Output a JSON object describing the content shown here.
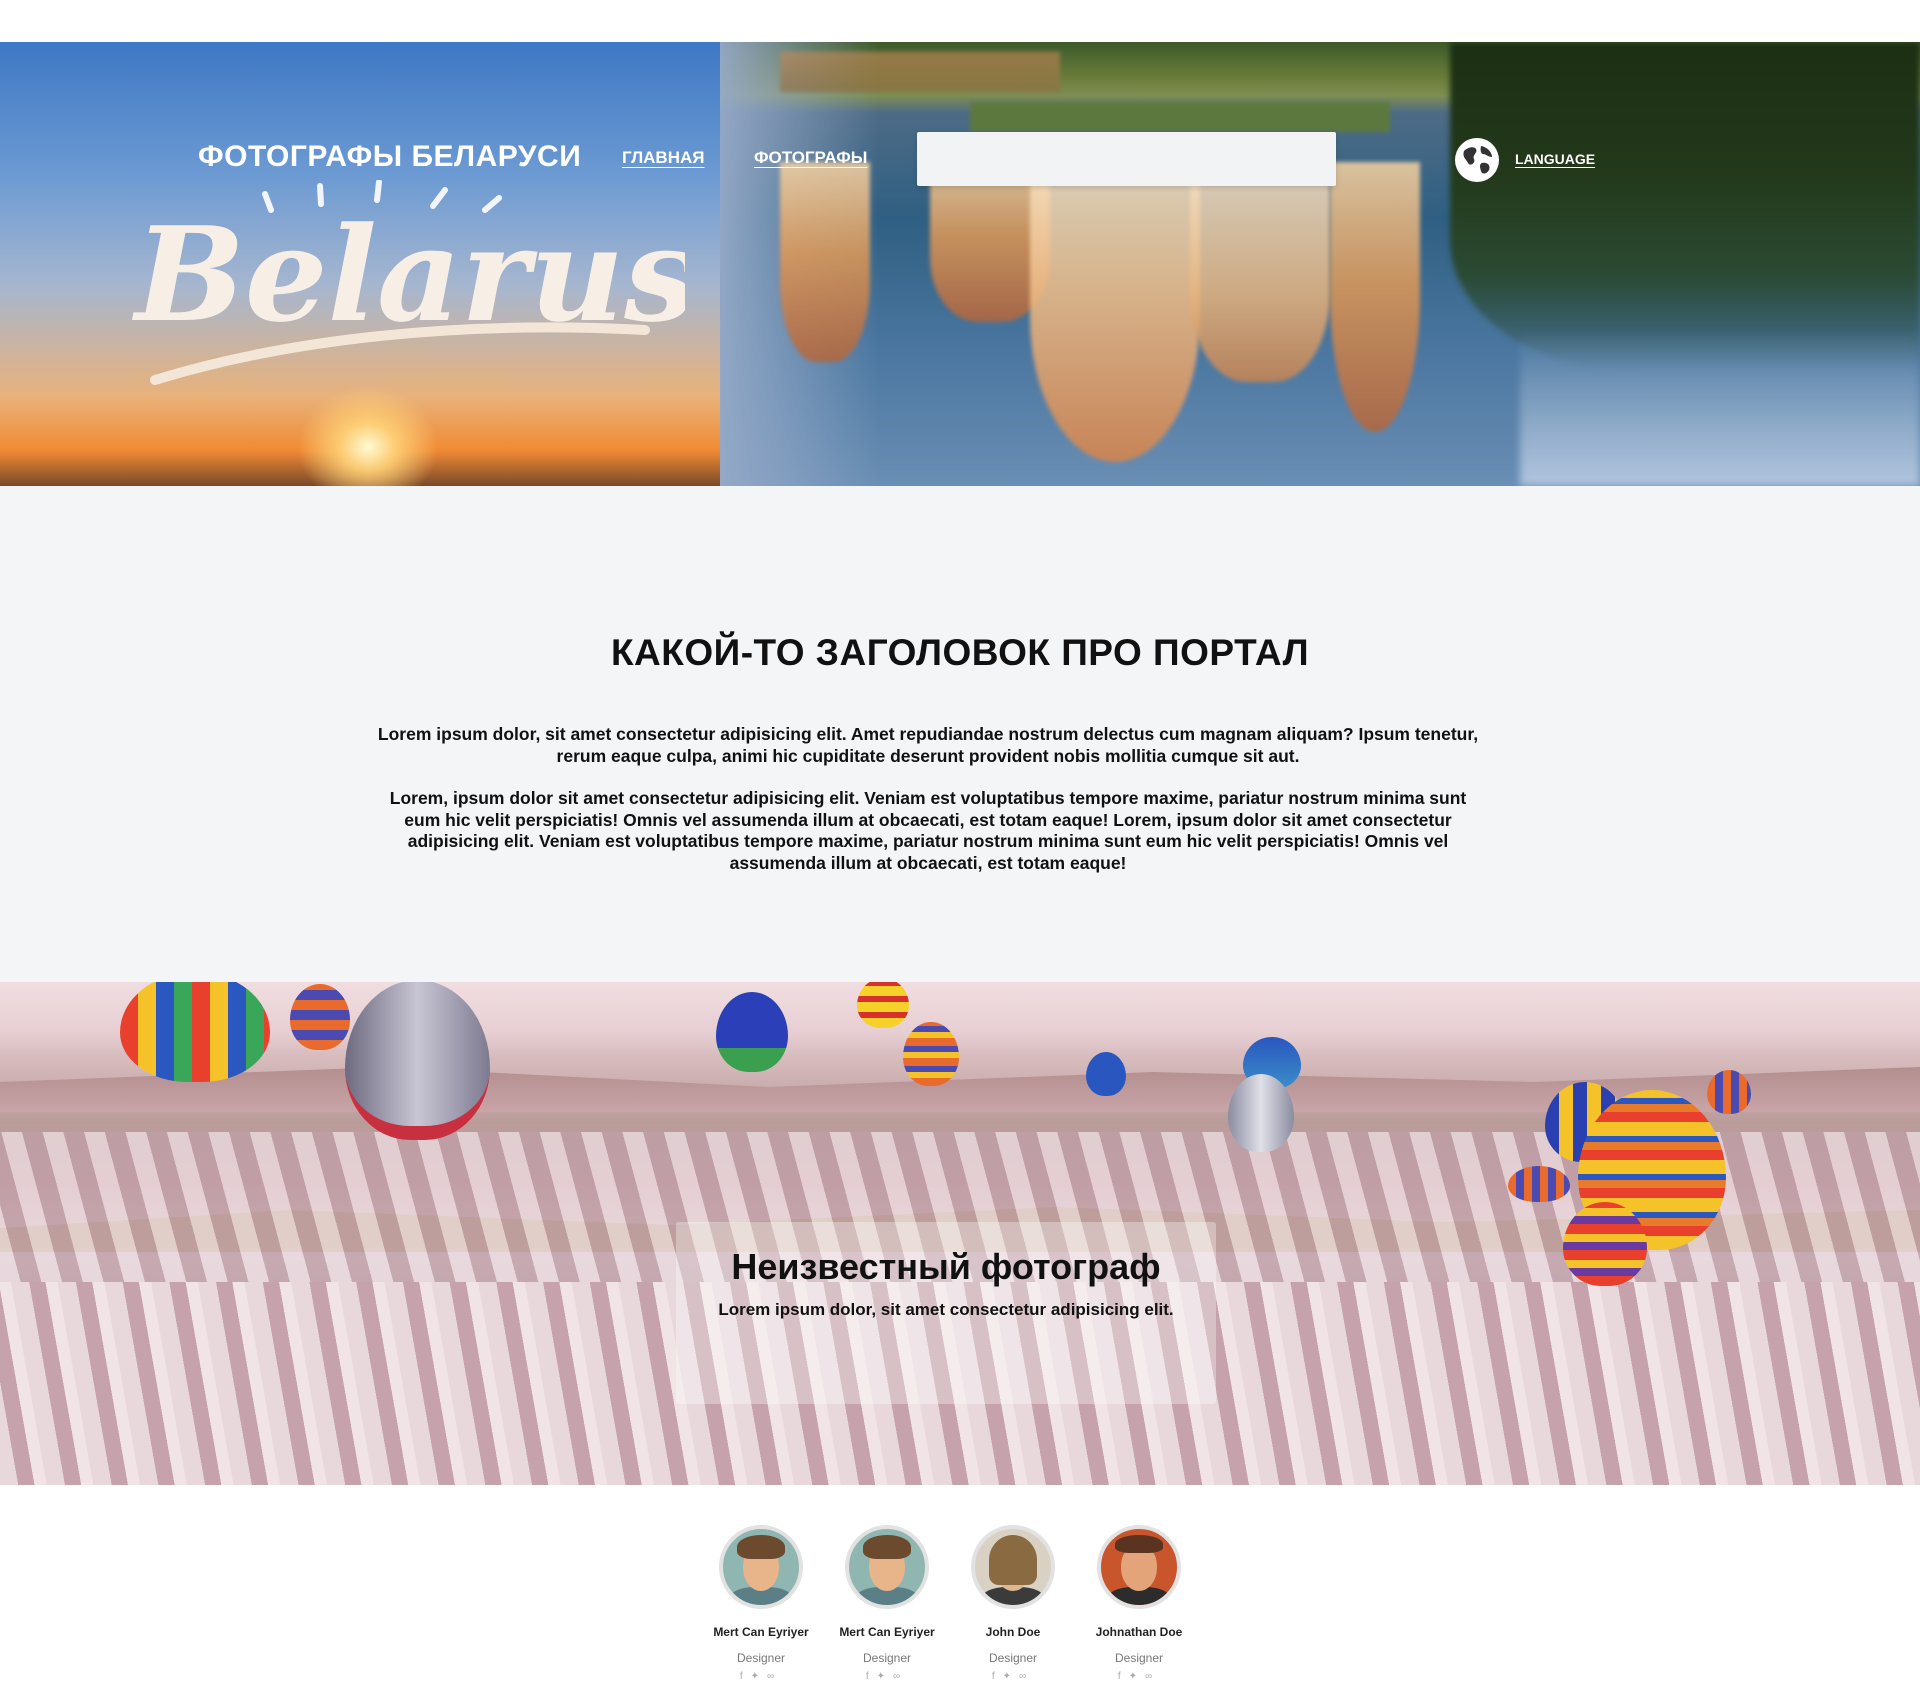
{
  "header": {
    "brand": "ФОТОГРАФЫ БЕЛАРУСИ",
    "nav": [
      {
        "label": "ГЛАВНАЯ"
      },
      {
        "label": "ФОТОГРАФЫ"
      }
    ],
    "search": {
      "value": "",
      "placeholder": ""
    },
    "language": "LANGUAGE",
    "logo_text": "Belarus"
  },
  "about": {
    "title": "КАКОЙ-ТО ЗАГОЛОВОК ПРО ПОРТАЛ",
    "paragraph1": "Lorem ipsum dolor, sit amet consectetur adipisicing elit. Amet repudiandae nostrum delectus cum magnam aliquam? Ipsum tenetur, rerum eaque culpa, animi hic cupiditate deserunt provident nobis mollitia cumque sit aut.",
    "paragraph2": "Lorem, ipsum dolor sit amet consectetur adipisicing elit. Veniam est voluptatibus tempore maxime, pariatur nostrum minima sunt eum hic velit perspiciatis! Omnis vel assumenda illum at obcaecati, est totam eaque! Lorem, ipsum dolor sit amet consectetur adipisicing elit. Veniam est voluptatibus tempore maxime, pariatur nostrum minima sunt eum hic velit perspiciatis! Omnis vel assumenda illum at obcaecati, est totam eaque!"
  },
  "featured": {
    "title": "Неизвестный фотограф",
    "subtitle": "Lorem ipsum dolor, sit amet consectetur adipisicing elit."
  },
  "team": [
    {
      "name": "Mert Can Eyriyer",
      "role": "Designer",
      "skin": "#e8b48a",
      "hair": "#6b4a2e",
      "bg": "#8fb6b0",
      "shirt": "#5a7f86"
    },
    {
      "name": "Mert Can Eyriyer",
      "role": "Designer",
      "skin": "#e8b48a",
      "hair": "#6b4a2e",
      "bg": "#8fb6b0",
      "shirt": "#5a7f86"
    },
    {
      "name": "John Doe",
      "role": "Designer",
      "skin": "#e0b890",
      "hair": "#8a6a40",
      "bg": "#d9d2c4",
      "shirt": "#3b3b3b"
    },
    {
      "name": "Johnathan Doe",
      "role": "Designer",
      "skin": "#e2a478",
      "hair": "#5a3420",
      "bg": "#c8552c",
      "shirt": "#2c2c2c"
    }
  ],
  "social_icons": [
    "facebook-icon",
    "twitter-icon",
    "link-icon"
  ],
  "colors": {
    "about_bg": "#f4f5f7",
    "text": "#111111",
    "search_bg": "#f2f3f5"
  }
}
